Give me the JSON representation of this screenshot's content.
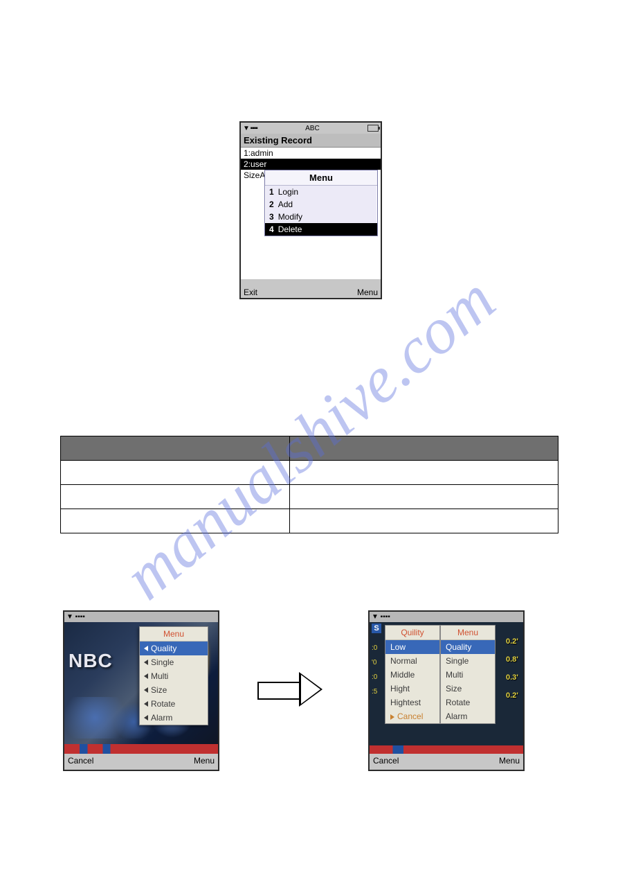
{
  "watermark": "manualshive.com",
  "phone1": {
    "status": {
      "signal": "▼ ▪▪▪▪",
      "mode": "ABC"
    },
    "title": "Existing Record",
    "rows": [
      "1:admin",
      "2:user"
    ],
    "selected_row": 1,
    "side_label": "SizeA",
    "menu": {
      "title": "Menu",
      "items": [
        {
          "num": "1",
          "label": "Login"
        },
        {
          "num": "2",
          "label": "Add"
        },
        {
          "num": "3",
          "label": "Modify"
        },
        {
          "num": "4",
          "label": "Delete"
        }
      ],
      "selected": 3
    },
    "softkeys": {
      "left": "Exit",
      "right": "Menu"
    }
  },
  "table": {
    "cols": 2,
    "rows": 4
  },
  "phone2": {
    "status_signal": "▼ ▪▪▪▪",
    "video_text": "NBC",
    "menu": {
      "title": "Menu",
      "items": [
        "Quality",
        "Single",
        "Multi",
        "Size",
        "Rotate",
        "Alarm"
      ],
      "selected": 0
    },
    "softkeys": {
      "left": "Cancel",
      "right": "Menu"
    }
  },
  "phone3": {
    "status_signal": "▼ ▪▪▪▪",
    "corner": "S",
    "right_values": [
      "0.2'",
      "0.8'",
      "0.3'",
      "0.2'"
    ],
    "left_values": [
      ":0",
      "'0",
      ":0",
      ":5"
    ],
    "quality_col": {
      "title": "Quility",
      "items": [
        "Low",
        "Normal",
        "Middle",
        "Hight",
        "Hightest",
        "Cancel"
      ],
      "selected": 0,
      "cancel_index": 5
    },
    "menu_col": {
      "title": "Menu",
      "items": [
        "Quality",
        "Single",
        "Multi",
        "Size",
        "Rotate",
        "Alarm"
      ],
      "selected": 0
    },
    "softkeys": {
      "left": "Cancel",
      "right": "Menu"
    }
  }
}
